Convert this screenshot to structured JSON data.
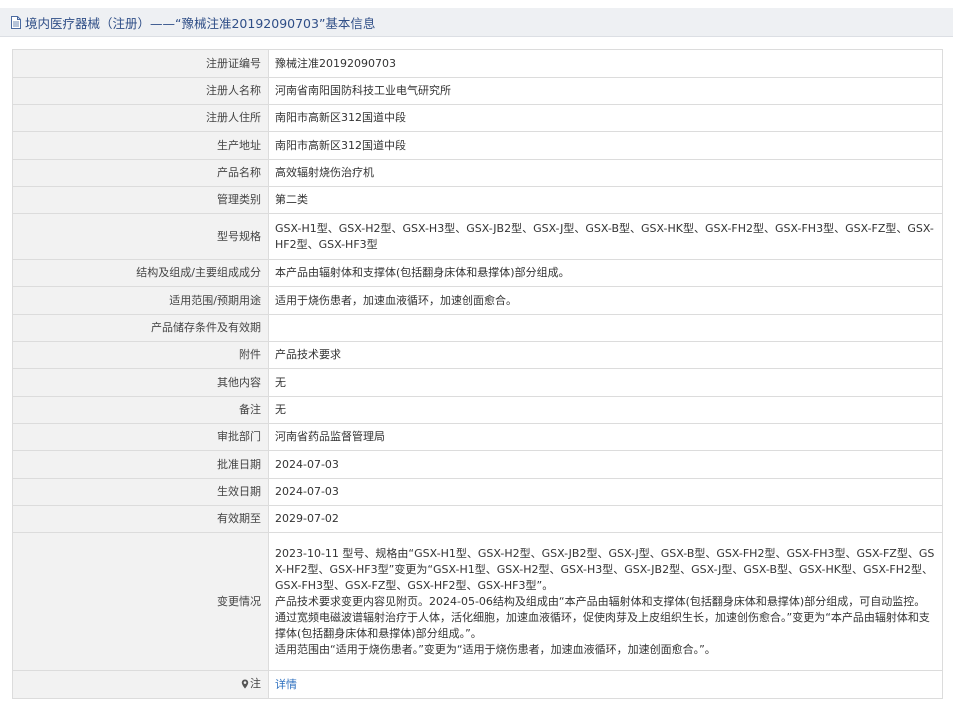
{
  "header": {
    "title": "境内医疗器械（注册）——“豫械注准20192090703”基本信息"
  },
  "rows": [
    {
      "label": "注册证编号",
      "value": "豫械注准20192090703"
    },
    {
      "label": "注册人名称",
      "value": "河南省南阳国防科技工业电气研究所"
    },
    {
      "label": "注册人住所",
      "value": "南阳市高新区312国道中段"
    },
    {
      "label": "生产地址",
      "value": "南阳市高新区312国道中段"
    },
    {
      "label": "产品名称",
      "value": "高效辐射烧伤治疗机"
    },
    {
      "label": "管理类别",
      "value": "第二类"
    },
    {
      "label": "型号规格",
      "value": "GSX-H1型、GSX-H2型、GSX-H3型、GSX-JB2型、GSX-J型、GSX-B型、GSX-HK型、GSX-FH2型、GSX-FH3型、GSX-FZ型、GSX-HF2型、GSX-HF3型"
    },
    {
      "label": "结构及组成/主要组成成分",
      "value": "本产品由辐射体和支撑体(包括翻身床体和悬撑体)部分组成。"
    },
    {
      "label": "适用范围/预期用途",
      "value": "适用于烧伤患者，加速血液循环，加速创面愈合。"
    },
    {
      "label": "产品储存条件及有效期",
      "value": ""
    },
    {
      "label": "附件",
      "value": "产品技术要求"
    },
    {
      "label": "其他内容",
      "value": "无"
    },
    {
      "label": "备注",
      "value": "无"
    },
    {
      "label": "审批部门",
      "value": "河南省药品监督管理局"
    },
    {
      "label": "批准日期",
      "value": "2024-07-03"
    },
    {
      "label": "生效日期",
      "value": "2024-07-03"
    },
    {
      "label": "有效期至",
      "value": "2029-07-02"
    }
  ],
  "changes": {
    "label": "变更情况",
    "paragraphs": [
      "2023-10-11 型号、规格由“GSX-H1型、GSX-H2型、GSX-JB2型、GSX-J型、GSX-B型、GSX-FH2型、GSX-FH3型、GSX-FZ型、GSX-HF2型、GSX-HF3型”变更为“GSX-H1型、GSX-H2型、GSX-H3型、GSX-JB2型、GSX-J型、GSX-B型、GSX-HK型、GSX-FH2型、GSX-FH3型、GSX-FZ型、GSX-HF2型、GSX-HF3型”。",
      "产品技术要求变更内容见附页。2024-05-06结构及组成由“本产品由辐射体和支撑体(包括翻身床体和悬撑体)部分组成，可自动监控。通过宽频电磁波谱辐射治疗于人体，活化细胞，加速血液循环，促使肉芽及上皮组织生长，加速创伤愈合。”变更为“本产品由辐射体和支撑体(包括翻身床体和悬撑体)部分组成。”。",
      "适用范围由“适用于烧伤患者。”变更为“适用于烧伤患者，加速血液循环，加速创面愈合。”。"
    ]
  },
  "note": {
    "label": "注",
    "link_text": "详情"
  },
  "colors": {
    "title_text": "#2f4e87",
    "link": "#2c6fbf",
    "label_bg": "#f2f2f2",
    "border": "#dcdcdc"
  },
  "icons": {
    "title": "document-icon",
    "note": "pin-icon"
  }
}
